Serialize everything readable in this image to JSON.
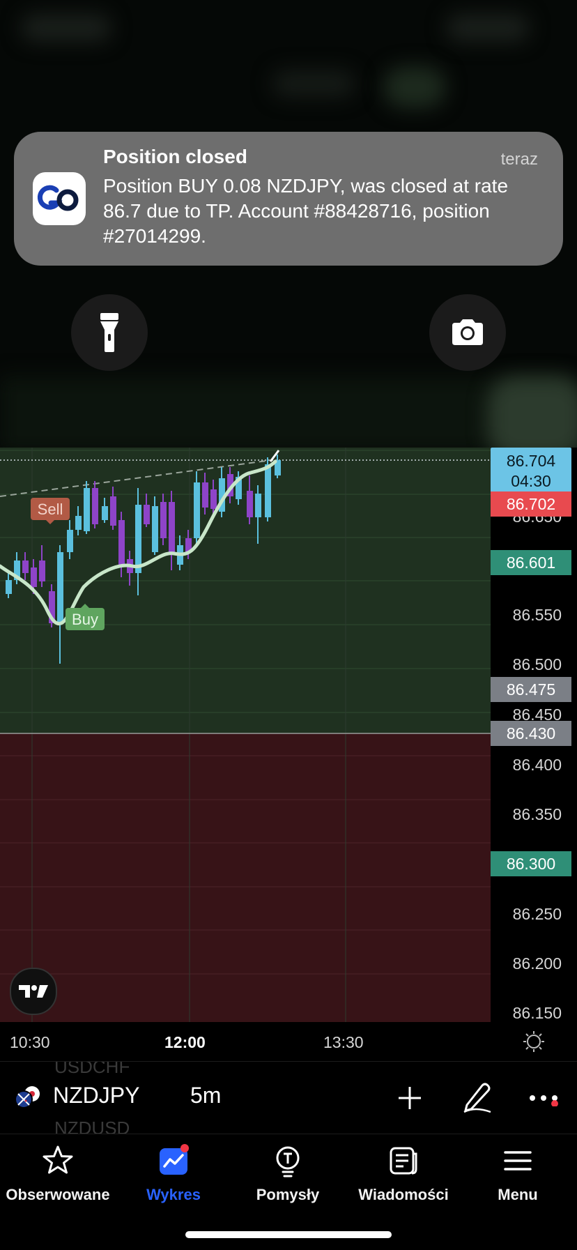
{
  "notification": {
    "title": "Position closed",
    "time": "teraz",
    "body": "Position BUY 0.08 NZDJPY, was closed at rate 86.7 due to TP. Account #88428716, position #27014299."
  },
  "chart": {
    "markers": {
      "sell": "Sell",
      "buy": "Buy"
    },
    "price_labels": [
      "86.650",
      "86.550",
      "86.500",
      "86.450",
      "86.400",
      "86.350",
      "86.250",
      "86.200",
      "86.150"
    ],
    "price_tags": {
      "current_price": "86.704",
      "countdown": "04:30",
      "bid": "86.702",
      "take_profit": "86.601",
      "entry": "86.475",
      "entry_line": "86.430",
      "stop_loss": "86.300"
    },
    "time_labels": [
      "10:30",
      "12:00",
      "13:30"
    ],
    "colors": {
      "up": "#5bc0de",
      "down": "#8e44c8",
      "profit_zone": "#1f3120",
      "loss_zone": "#371317",
      "ma_line": "#c8e6c9"
    }
  },
  "toolbar": {
    "symbol": "NZDJPY",
    "interval": "5m",
    "ghost_above": "USDCHF",
    "ghost_below": "NZDUSD"
  },
  "nav": {
    "items": [
      {
        "label": "Obserwowane",
        "icon": "star-icon"
      },
      {
        "label": "Wykres",
        "icon": "chart-icon"
      },
      {
        "label": "Pomysły",
        "icon": "lightbulb-icon"
      },
      {
        "label": "Wiadomości",
        "icon": "news-icon"
      },
      {
        "label": "Menu",
        "icon": "hamburger-icon"
      }
    ],
    "active_color": "#2962ff"
  }
}
